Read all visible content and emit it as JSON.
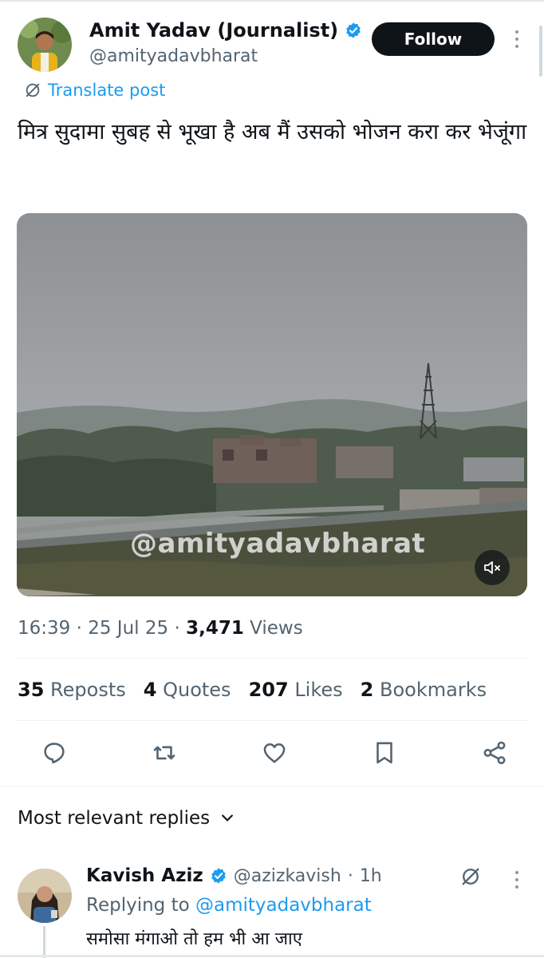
{
  "post": {
    "author_name": "Amit Yadav (Journalist)",
    "author_handle": "@amityadavbharat",
    "follow_label": "Follow",
    "translate_label": "Translate post",
    "text": "मित्र सुदामा सुबह से भूखा है अब मैं उसको भोजन करा कर भेजूंगा",
    "video_watermark": "@amityadavbharat",
    "time": "16:39",
    "date": "25 Jul 25",
    "views_count": "3,471",
    "views_label": "Views",
    "reposts_count": "35",
    "reposts_label": "Reposts",
    "quotes_count": "4",
    "quotes_label": "Quotes",
    "likes_count": "207",
    "likes_label": "Likes",
    "bookmarks_count": "2",
    "bookmarks_label": "Bookmarks"
  },
  "replies": {
    "heading": "Most relevant replies",
    "items": [
      {
        "author_name": "Kavish Aziz",
        "author_handle": "@azizkavish",
        "age": "1h",
        "replying_prefix": "Replying to",
        "replying_to": "@amityadavbharat",
        "text": "समोसा मंगाओ तो हम भी आ जाए"
      }
    ]
  },
  "colors": {
    "accent": "#1d9bf0",
    "text_primary": "#0f1419",
    "text_secondary": "#536471",
    "follow_bg": "#0f1419",
    "verified": "#1d9bf0"
  },
  "icons": {
    "verified": "verified-badge-icon",
    "translate": "translate-icon",
    "more": "more-options-icon",
    "mute": "mute-icon",
    "reply": "reply-icon",
    "repost": "repost-icon",
    "like": "like-icon",
    "bookmark": "bookmark-icon",
    "share": "share-icon",
    "chevron": "chevron-down-icon",
    "grok": "grok-icon"
  }
}
